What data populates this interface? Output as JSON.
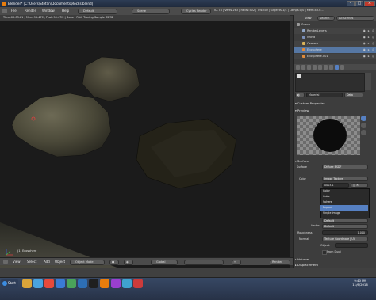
{
  "window": {
    "title": "Blender* [C:\\Users\\Stefan\\Documents\\Rocks.blend]"
  },
  "topbar": {
    "menus": [
      "File",
      "Render",
      "Window",
      "Help"
    ],
    "layout": "Default",
    "scene": "Scene",
    "engine": "Cycles Render",
    "stats": "v2.78 | Verts:263 | Faces:502 | Tris:502 | Objects:1/4 | Lamps:0/0 | Mem:43.0..."
  },
  "render_info": "Time:00:03.81 | Mem:96.47M, Peak:96.47M | Done | Path Tracing Sample 32/32",
  "viewport": {
    "object_label": "(1) Ecosphere",
    "header": {
      "menus": [
        "View",
        "Select",
        "Add",
        "Object"
      ],
      "mode": "Object Mode",
      "pivot": "Global"
    }
  },
  "outliner": {
    "header": {
      "view": "View",
      "search": "Search",
      "filter": "All Scenes"
    },
    "rows": [
      {
        "label": "Scene",
        "indent": 0,
        "color": "#9a9a9a"
      },
      {
        "label": "RenderLayers",
        "indent": 1,
        "color": "#8fa4c4"
      },
      {
        "label": "World",
        "indent": 1,
        "color": "#7a8fb8"
      },
      {
        "label": "Camera",
        "indent": 1,
        "color": "#d9b25a"
      },
      {
        "label": "Ecosphere",
        "indent": 1,
        "color": "#e08a3a",
        "selected": true
      },
      {
        "label": "Ecosphere.001",
        "indent": 1,
        "color": "#e08a3a"
      }
    ]
  },
  "properties": {
    "material_slot": "Material",
    "material_tab": "Data",
    "sections": [
      "Custom Properties",
      "Preview",
      "Surface"
    ],
    "surface_label": "Surface",
    "surface_value": "Diffuse BSDF",
    "color_label": "Color",
    "color_value": "Image Texture",
    "image_name": "0003.1",
    "projection_menu": [
      "Color",
      "Cube",
      "Sphere",
      "Repeat",
      "Single Image"
    ],
    "default_label": "Default",
    "vector_label": "Vector",
    "vector_value": "Default",
    "roughness_label": "Roughness",
    "roughness_value": "1.000",
    "normal_label": "Normal",
    "normal_value": "Texture Coordinate | UV",
    "object_label": "Object:",
    "from_dupli_label": "From Dupli",
    "closed_sections": [
      "Volume",
      "Displacement",
      "Settings"
    ]
  },
  "taskbar": {
    "start_label": "Start",
    "icon_colors": [
      "#d9a43a",
      "#4aa3df",
      "#e84a3b",
      "#3a7bd5",
      "#4aa35a",
      "#2d6eb5",
      "#1f1f1f",
      "#e87d0d",
      "#9a3fd0",
      "#3fa3d0",
      "#cc3b3b"
    ],
    "clock_time": "9:40 PM",
    "clock_date": "11/6/2016"
  }
}
